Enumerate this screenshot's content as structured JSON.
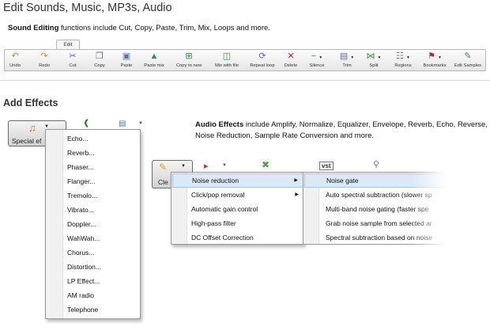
{
  "header": {
    "title": "Edit Sounds, Music, MP3s, Audio"
  },
  "sound_editing": {
    "strong": "Sound Editing",
    "text": " functions include Cut, Copy, Paste, Trim, Mix, Loops and more."
  },
  "ribbon": {
    "tab": "Edit",
    "buttons": [
      {
        "label": "Undo",
        "icon": "undo-icon"
      },
      {
        "label": "Redo",
        "icon": "redo-icon"
      },
      {
        "label": "Cut",
        "icon": "scissors-icon"
      },
      {
        "label": "Copy",
        "icon": "copy-icon"
      },
      {
        "label": "Paste",
        "icon": "paste-icon"
      },
      {
        "label": "Paste mix",
        "icon": "paste-mix-icon"
      },
      {
        "label": "Copy to new",
        "icon": "copy-to-new-icon"
      },
      {
        "label": "Mix with file",
        "icon": "mix-file-icon"
      },
      {
        "label": "Repeat loop",
        "icon": "repeat-loop-icon"
      },
      {
        "label": "Delete",
        "icon": "delete-icon"
      },
      {
        "label": "Silence",
        "icon": "silence-icon"
      },
      {
        "label": "Trim",
        "icon": "trim-icon"
      },
      {
        "label": "Split",
        "icon": "split-icon"
      },
      {
        "label": "Regions",
        "icon": "regions-icon"
      },
      {
        "label": "Bookmarks",
        "icon": "bookmark-icon"
      },
      {
        "label": "Edit Samples",
        "icon": "pencil-icon"
      }
    ]
  },
  "add_effects": {
    "title": "Add Effects",
    "strong": "Audio Effects",
    "text": " include Amplify, Normalize, Equalizer, Envelope, Reverb, Echo, Reverse, Noise Reduction, Sample Rate Conversion and more."
  },
  "special_effects_button": {
    "label": "Special ef"
  },
  "special_effects_menu": [
    "Echo...",
    "Reverb...",
    "Phaser...",
    "Flanger...",
    "Tremolo...",
    "Vibrato...",
    "Doppler...",
    "WahWah...",
    "Chorus...",
    "Distortion...",
    "LP Effect...",
    "AM radio",
    "Telephone"
  ],
  "clean_button": {
    "label": "Cle"
  },
  "clean_menu": [
    {
      "label": "Noise reduction",
      "submenu": true
    },
    {
      "label": "Click/pop removal",
      "submenu": true
    },
    {
      "label": "Automatic gain control",
      "submenu": false
    },
    {
      "label": "High-pass filter",
      "submenu": false
    },
    {
      "label": "DC Offset Correction",
      "submenu": false
    }
  ],
  "noise_reduction_menu": [
    "Noise gate",
    "Auto spectral subtraction (slower sp",
    "Multi-band noise gating (faster spe",
    "Grab noise sample from selected ar",
    "Spectral subtraction based on noise"
  ]
}
